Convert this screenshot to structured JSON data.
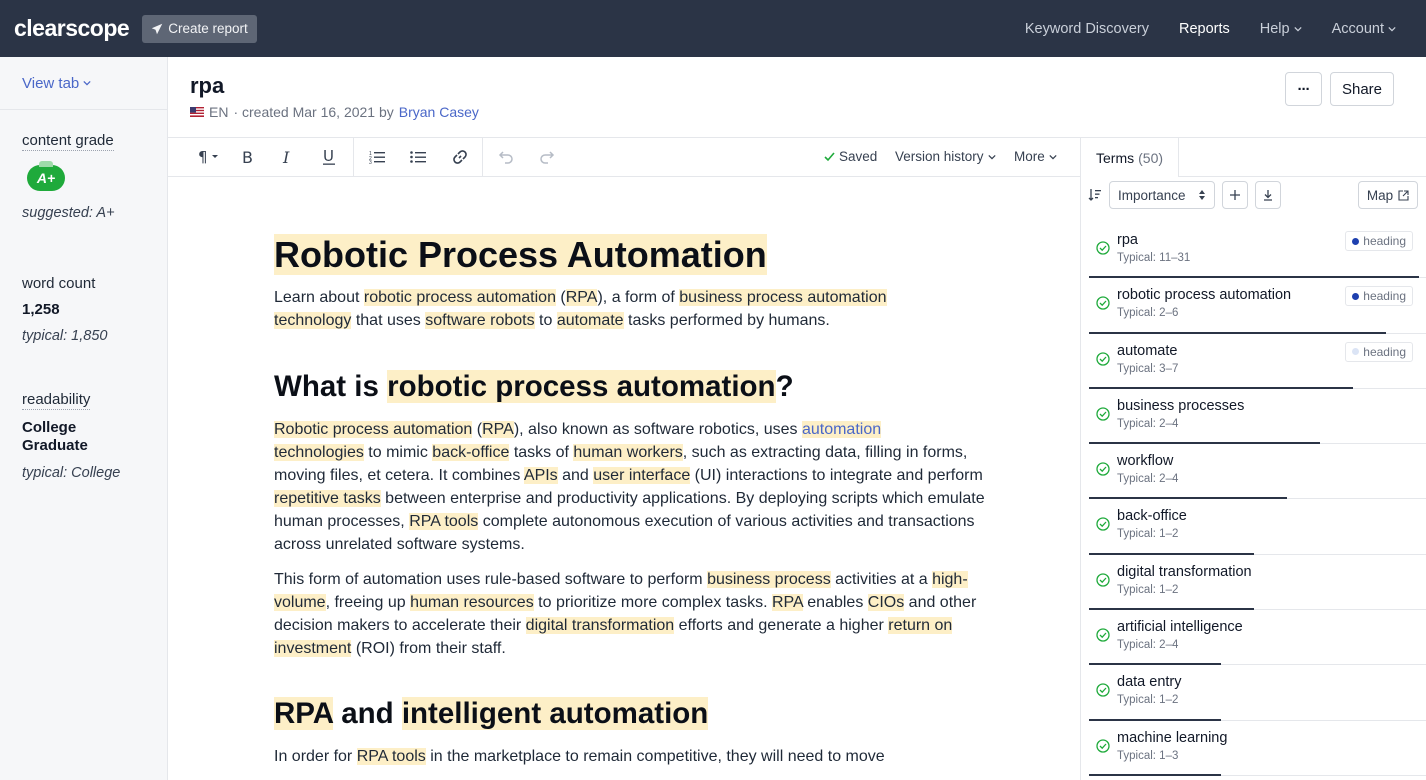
{
  "topbar": {
    "logo": "clearscope",
    "create_report": "Create report",
    "nav": {
      "keyword_discovery": "Keyword Discovery",
      "reports": "Reports",
      "help": "Help",
      "account": "Account"
    }
  },
  "sidebar": {
    "view_tab": "View tab",
    "content_grade": {
      "label": "content grade",
      "grade": "A+",
      "suggested": "suggested: A+"
    },
    "word_count": {
      "label": "word count",
      "value": "1,258",
      "typical": "typical: 1,850"
    },
    "readability": {
      "label": "readability",
      "value": "College Graduate",
      "typical": "typical: College"
    }
  },
  "header": {
    "title": "rpa",
    "lang": "EN",
    "meta_created": "· created Mar 16, 2021 by",
    "author": "Bryan Casey",
    "more_button": "···",
    "share_button": "Share"
  },
  "toolbar": {
    "saved": "Saved",
    "version_history": "Version history",
    "more": "More"
  },
  "editor": {
    "h1": "Robotic Process Automation",
    "p1": {
      "t1": "Learn about ",
      "k1": "robotic process automation",
      "t2": " (",
      "k2": "RPA",
      "t3": "), a form of ",
      "k3": "business process automation",
      "t4": " ",
      "k4": "technology",
      "t5": " that uses ",
      "k5": "software robots",
      "t6": " to ",
      "k6": "automate",
      "t7": " tasks performed by humans."
    },
    "h2a": {
      "t1": "What is ",
      "k1": "robotic process automation",
      "t2": "?"
    },
    "p2": {
      "k1": "Robotic process automation",
      "t1": " (",
      "k2": "RPA",
      "t2": "), also known as software robotics, uses ",
      "k3": "automation",
      "t3": " ",
      "k4": "technologies",
      "t4": " to mimic ",
      "k5": "back-office",
      "t5": " tasks of ",
      "k6": "human workers",
      "t6": ", such as extracting data, filling in forms, moving files, et cetera. It combines ",
      "k7": "APIs",
      "t7": " and ",
      "k8": "user interface",
      "t8": " (UI) interactions to integrate and perform ",
      "k9": "repetitive tasks",
      "t9": " between enterprise and productivity applications. By deploying scripts which emulate human processes, ",
      "k10": "RPA tools",
      "t10": " complete autonomous execution of various activities and transactions across unrelated software systems."
    },
    "p3": {
      "t1": "This form of automation uses rule-based software to perform ",
      "k1": "business process",
      "t2": " activities at a ",
      "k2": "high-volume",
      "t3": ", freeing up ",
      "k3": "human resources",
      "t4": " to prioritize more complex tasks. ",
      "k4": "RPA",
      "t5": " enables ",
      "k5": "CIOs",
      "t6": " and other decision makers to accelerate their ",
      "k6": "digital transformation",
      "t7": " efforts and generate a higher ",
      "k7": "return on investment",
      "t8": " (ROI) from their staff."
    },
    "h2b": {
      "k1": "RPA",
      "t1": " and ",
      "k2": "intelligent automation"
    },
    "p4": {
      "t1": "In order for ",
      "k1": "RPA tools",
      "t2": " in the marketplace to remain competitive, they will need to move"
    }
  },
  "terms_panel": {
    "tab_label": "Terms",
    "tab_count": "(50)",
    "sort_label": "Importance",
    "map_label": "Map",
    "terms": [
      {
        "name": "rpa",
        "typical": "Typical: 11–31",
        "badge": "heading",
        "badge_dot": "#1e40af",
        "fill": 1.0
      },
      {
        "name": "robotic process automation",
        "typical": "Typical: 2–6",
        "badge": "heading",
        "badge_dot": "#1e40af",
        "fill": 0.9
      },
      {
        "name": "automate",
        "typical": "Typical: 3–7",
        "badge": "heading",
        "badge_dot": "#dbe4f5",
        "fill": 0.8
      },
      {
        "name": "business processes",
        "typical": "Typical: 2–4",
        "badge": "",
        "badge_dot": "",
        "fill": 0.7
      },
      {
        "name": "workflow",
        "typical": "Typical: 2–4",
        "badge": "",
        "badge_dot": "",
        "fill": 0.6
      },
      {
        "name": "back-office",
        "typical": "Typical: 1–2",
        "badge": "",
        "badge_dot": "",
        "fill": 0.5
      },
      {
        "name": "digital transformation",
        "typical": "Typical: 1–2",
        "badge": "",
        "badge_dot": "",
        "fill": 0.5
      },
      {
        "name": "artificial intelligence",
        "typical": "Typical: 2–4",
        "badge": "",
        "badge_dot": "",
        "fill": 0.4
      },
      {
        "name": "data entry",
        "typical": "Typical: 1–2",
        "badge": "",
        "badge_dot": "",
        "fill": 0.4
      },
      {
        "name": "machine learning",
        "typical": "Typical: 1–3",
        "badge": "",
        "badge_dot": "",
        "fill": 0.4
      }
    ]
  }
}
